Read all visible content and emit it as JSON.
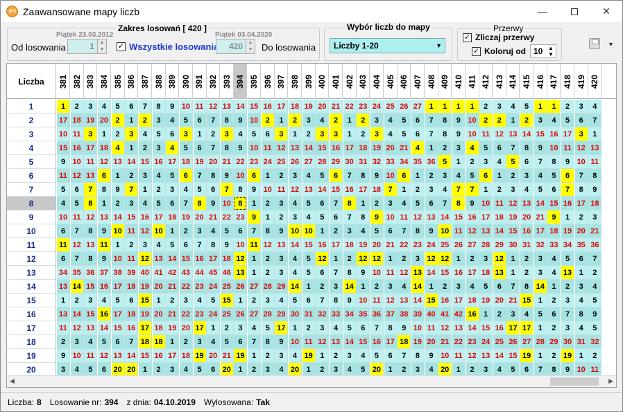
{
  "window": {
    "title": "Zaawansowane mapy liczb",
    "icon_text": "JPS"
  },
  "range": {
    "group_title": "Zakres losowań [ 420 ]",
    "from_date": "Piątek 23.03.2012",
    "to_date": "Piątek 03.04.2020",
    "from_label": "Od losowania",
    "to_label": "Do losowania",
    "from_value": "1",
    "to_value": "420",
    "all_label": "Wszystkie losowania",
    "all_checked": true
  },
  "numbers": {
    "group_title": "Wybór liczb do mapy",
    "selected": "Liczby  1-20"
  },
  "gaps": {
    "group_title": "Przerwy",
    "count_label": "Zliczaj przerwy",
    "count_checked": true,
    "color_label": "Koloruj od",
    "color_checked": true,
    "color_value": "10"
  },
  "grid": {
    "corner_label": "Liczba",
    "columns": [
      "381",
      "382",
      "383",
      "384",
      "385",
      "386",
      "387",
      "388",
      "389",
      "390",
      "391",
      "392",
      "393",
      "394",
      "395",
      "396",
      "397",
      "398",
      "399",
      "400",
      "401",
      "402",
      "403",
      "404",
      "405",
      "406",
      "407",
      "408",
      "409",
      "410",
      "411",
      "412",
      "413",
      "414",
      "415",
      "416",
      "417",
      "418",
      "419",
      "420"
    ],
    "selected_column": "394",
    "selected_row": "8",
    "rows": [
      {
        "label": "1",
        "cells": [
          "1",
          "2",
          "3",
          "4",
          "5",
          "6",
          "7",
          "8",
          "9",
          "10",
          "11",
          "12",
          "13",
          "14",
          "15",
          "16",
          "17",
          "18",
          "19",
          "20",
          "21",
          "22",
          "23",
          "24",
          "25",
          "26",
          "27",
          "1",
          "1",
          "1",
          "1",
          "2",
          "3",
          "4",
          "5",
          "1",
          "1",
          "2",
          "3",
          "4"
        ]
      },
      {
        "label": "2",
        "cells": [
          "17",
          "18",
          "19",
          "20",
          "2",
          "1",
          "2",
          "3",
          "4",
          "5",
          "6",
          "7",
          "8",
          "9",
          "10",
          "2",
          "1",
          "2",
          "3",
          "4",
          "2",
          "1",
          "2",
          "3",
          "4",
          "5",
          "6",
          "7",
          "8",
          "9",
          "10",
          "2",
          "2",
          "1",
          "2",
          "3",
          "4",
          "5",
          "6",
          "7"
        ]
      },
      {
        "label": "3",
        "cells": [
          "10",
          "11",
          "3",
          "1",
          "2",
          "3",
          "4",
          "5",
          "6",
          "3",
          "1",
          "2",
          "3",
          "4",
          "5",
          "6",
          "3",
          "1",
          "2",
          "3",
          "3",
          "1",
          "2",
          "3",
          "4",
          "5",
          "6",
          "7",
          "8",
          "9",
          "10",
          "11",
          "12",
          "13",
          "14",
          "15",
          "16",
          "17",
          "3",
          "1"
        ]
      },
      {
        "label": "4",
        "cells": [
          "15",
          "16",
          "17",
          "18",
          "4",
          "1",
          "2",
          "3",
          "4",
          "5",
          "6",
          "7",
          "8",
          "9",
          "10",
          "11",
          "12",
          "13",
          "14",
          "15",
          "16",
          "17",
          "18",
          "19",
          "20",
          "21",
          "4",
          "1",
          "2",
          "3",
          "4",
          "5",
          "6",
          "7",
          "8",
          "9",
          "10",
          "11",
          "12",
          "13"
        ]
      },
      {
        "label": "5",
        "cells": [
          "9",
          "10",
          "11",
          "12",
          "13",
          "14",
          "15",
          "16",
          "17",
          "18",
          "19",
          "20",
          "21",
          "22",
          "23",
          "24",
          "25",
          "26",
          "27",
          "28",
          "29",
          "30",
          "31",
          "32",
          "33",
          "34",
          "35",
          "36",
          "5",
          "1",
          "2",
          "3",
          "4",
          "5",
          "6",
          "7",
          "8",
          "9",
          "10",
          "11"
        ]
      },
      {
        "label": "6",
        "cells": [
          "11",
          "12",
          "13",
          "6",
          "1",
          "2",
          "3",
          "4",
          "5",
          "6",
          "7",
          "8",
          "9",
          "10",
          "6",
          "1",
          "2",
          "3",
          "4",
          "5",
          "6",
          "7",
          "8",
          "9",
          "10",
          "6",
          "1",
          "2",
          "3",
          "4",
          "5",
          "6",
          "1",
          "2",
          "3",
          "4",
          "5",
          "6",
          "7",
          "8"
        ]
      },
      {
        "label": "7",
        "cells": [
          "5",
          "6",
          "7",
          "8",
          "9",
          "7",
          "1",
          "2",
          "3",
          "4",
          "5",
          "6",
          "7",
          "8",
          "9",
          "10",
          "11",
          "12",
          "13",
          "14",
          "15",
          "16",
          "17",
          "18",
          "7",
          "1",
          "2",
          "3",
          "4",
          "7",
          "7",
          "1",
          "2",
          "3",
          "4",
          "5",
          "6",
          "7",
          "8",
          "9"
        ]
      },
      {
        "label": "8",
        "cells": [
          "4",
          "5",
          "8",
          "1",
          "2",
          "3",
          "4",
          "5",
          "6",
          "7",
          "8",
          "9",
          "10",
          "8",
          "1",
          "2",
          "3",
          "4",
          "5",
          "6",
          "7",
          "8",
          "1",
          "2",
          "3",
          "4",
          "5",
          "6",
          "7",
          "8",
          "9",
          "10",
          "11",
          "12",
          "13",
          "14",
          "15",
          "16",
          "17",
          "18"
        ]
      },
      {
        "label": "9",
        "cells": [
          "10",
          "11",
          "12",
          "13",
          "14",
          "15",
          "16",
          "17",
          "18",
          "19",
          "20",
          "21",
          "22",
          "23",
          "9",
          "1",
          "2",
          "3",
          "4",
          "5",
          "6",
          "7",
          "8",
          "9",
          "10",
          "11",
          "12",
          "13",
          "14",
          "15",
          "16",
          "17",
          "18",
          "19",
          "20",
          "21",
          "9",
          "1",
          "2",
          "3"
        ]
      },
      {
        "label": "10",
        "cells": [
          "6",
          "7",
          "8",
          "9",
          "10",
          "11",
          "12",
          "10",
          "1",
          "2",
          "3",
          "4",
          "5",
          "6",
          "7",
          "8",
          "9",
          "10",
          "10",
          "1",
          "2",
          "3",
          "4",
          "5",
          "6",
          "7",
          "8",
          "9",
          "10",
          "11",
          "12",
          "13",
          "14",
          "15",
          "16",
          "17",
          "18",
          "19",
          "20",
          "21"
        ]
      },
      {
        "label": "11",
        "cells": [
          "11",
          "12",
          "13",
          "11",
          "1",
          "2",
          "3",
          "4",
          "5",
          "6",
          "7",
          "8",
          "9",
          "10",
          "11",
          "12",
          "13",
          "14",
          "15",
          "16",
          "17",
          "18",
          "19",
          "20",
          "21",
          "22",
          "23",
          "24",
          "25",
          "26",
          "27",
          "28",
          "29",
          "30",
          "31",
          "32",
          "33",
          "34",
          "35",
          "36"
        ]
      },
      {
        "label": "12",
        "cells": [
          "6",
          "7",
          "8",
          "9",
          "10",
          "11",
          "12",
          "13",
          "14",
          "15",
          "16",
          "17",
          "18",
          "12",
          "1",
          "2",
          "3",
          "4",
          "5",
          "12",
          "1",
          "2",
          "12",
          "12",
          "1",
          "2",
          "3",
          "12",
          "12",
          "1",
          "2",
          "3",
          "12",
          "1",
          "2",
          "3",
          "4",
          "5",
          "6",
          "7"
        ]
      },
      {
        "label": "13",
        "cells": [
          "34",
          "35",
          "36",
          "37",
          "38",
          "39",
          "40",
          "41",
          "42",
          "43",
          "44",
          "45",
          "46",
          "13",
          "1",
          "2",
          "3",
          "4",
          "5",
          "6",
          "7",
          "8",
          "9",
          "10",
          "11",
          "12",
          "13",
          "14",
          "15",
          "16",
          "17",
          "18",
          "13",
          "1",
          "2",
          "3",
          "4",
          "13",
          "1",
          "2"
        ]
      },
      {
        "label": "14",
        "cells": [
          "13",
          "14",
          "15",
          "16",
          "17",
          "18",
          "19",
          "20",
          "21",
          "22",
          "23",
          "24",
          "25",
          "26",
          "27",
          "28",
          "29",
          "14",
          "1",
          "2",
          "3",
          "14",
          "1",
          "2",
          "3",
          "4",
          "14",
          "1",
          "2",
          "3",
          "4",
          "5",
          "6",
          "7",
          "8",
          "14",
          "1",
          "2",
          "3",
          "4"
        ]
      },
      {
        "label": "15",
        "cells": [
          "1",
          "2",
          "3",
          "4",
          "5",
          "6",
          "15",
          "1",
          "2",
          "3",
          "4",
          "5",
          "15",
          "1",
          "2",
          "3",
          "4",
          "5",
          "6",
          "7",
          "8",
          "9",
          "10",
          "11",
          "12",
          "13",
          "14",
          "15",
          "16",
          "17",
          "18",
          "19",
          "20",
          "21",
          "15",
          "1",
          "2",
          "3",
          "4",
          "5"
        ]
      },
      {
        "label": "16",
        "cells": [
          "13",
          "14",
          "15",
          "16",
          "17",
          "18",
          "19",
          "20",
          "21",
          "22",
          "23",
          "24",
          "25",
          "26",
          "27",
          "28",
          "29",
          "30",
          "31",
          "32",
          "33",
          "34",
          "35",
          "36",
          "37",
          "38",
          "39",
          "40",
          "41",
          "42",
          "16",
          "1",
          "2",
          "3",
          "4",
          "5",
          "6",
          "7",
          "8",
          "9"
        ]
      },
      {
        "label": "17",
        "cells": [
          "11",
          "12",
          "13",
          "14",
          "15",
          "16",
          "17",
          "18",
          "19",
          "20",
          "17",
          "1",
          "2",
          "3",
          "4",
          "5",
          "17",
          "1",
          "2",
          "3",
          "4",
          "5",
          "6",
          "7",
          "8",
          "9",
          "10",
          "11",
          "12",
          "13",
          "14",
          "15",
          "16",
          "17",
          "17",
          "1",
          "2",
          "3",
          "4",
          "5"
        ]
      },
      {
        "label": "18",
        "cells": [
          "2",
          "3",
          "4",
          "5",
          "6",
          "7",
          "18",
          "18",
          "1",
          "2",
          "3",
          "4",
          "5",
          "6",
          "7",
          "8",
          "9",
          "10",
          "11",
          "12",
          "13",
          "14",
          "15",
          "16",
          "17",
          "18",
          "19",
          "20",
          "21",
          "22",
          "23",
          "24",
          "25",
          "26",
          "27",
          "28",
          "29",
          "30",
          "31",
          "32"
        ]
      },
      {
        "label": "19",
        "cells": [
          "9",
          "10",
          "11",
          "12",
          "13",
          "14",
          "15",
          "16",
          "17",
          "18",
          "19",
          "20",
          "21",
          "19",
          "1",
          "2",
          "3",
          "4",
          "19",
          "1",
          "2",
          "3",
          "4",
          "5",
          "6",
          "7",
          "8",
          "9",
          "10",
          "11",
          "12",
          "13",
          "14",
          "15",
          "19",
          "1",
          "2",
          "19",
          "1",
          "2"
        ]
      },
      {
        "label": "20",
        "cells": [
          "3",
          "4",
          "5",
          "6",
          "20",
          "20",
          "1",
          "2",
          "3",
          "4",
          "5",
          "6",
          "20",
          "1",
          "2",
          "3",
          "4",
          "20",
          "1",
          "2",
          "3",
          "4",
          "5",
          "20",
          "1",
          "2",
          "3",
          "4",
          "20",
          "1",
          "2",
          "3",
          "4",
          "5",
          "6",
          "7",
          "8",
          "9",
          "10",
          "11"
        ]
      }
    ]
  },
  "status": {
    "liczba_label": "Liczba:",
    "liczba_value": "8",
    "draw_label": "Losowanie nr:",
    "draw_value": "394",
    "date_label": "z dnia:",
    "date_value": "04.10.2019",
    "drawn_label": "Wylosowana:",
    "drawn_value": "Tak"
  },
  "colors": {
    "highlight": "#ffff00",
    "row_even": "#bdf0f0",
    "row_odd": "#a6e4e4",
    "gap_red": "#e00000",
    "label_blue": "#1a2e8a"
  }
}
